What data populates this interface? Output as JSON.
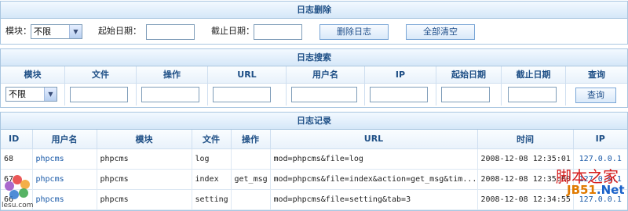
{
  "delete_panel": {
    "title": "日志删除",
    "module_label": "模块：",
    "module_value": "不限",
    "start_label": "起始日期：",
    "end_label": "截止日期：",
    "delete_button": "删除日志",
    "clear_all_button": "全部清空"
  },
  "search_panel": {
    "title": "日志搜索",
    "headers": [
      "模块",
      "文件",
      "操作",
      "URL",
      "用户名",
      "IP",
      "起始日期",
      "截止日期",
      "查询"
    ],
    "module_value": "不限",
    "search_button": "查询"
  },
  "log_panel": {
    "title": "日志记录",
    "headers": [
      "ID",
      "用户名",
      "模块",
      "文件",
      "操作",
      "URL",
      "时间",
      "IP"
    ],
    "rows": [
      {
        "id": "68",
        "user": "phpcms",
        "module": "phpcms",
        "file": "log",
        "action": "",
        "url": "mod=phpcms&file=log",
        "time": "2008-12-08 12:35:01",
        "ip": "127.0.0.1"
      },
      {
        "id": "67",
        "user": "phpcms",
        "module": "phpcms",
        "file": "index",
        "action": "get_msg",
        "url": "mod=phpcms&file=index&action=get_msg&tim...",
        "time": "2008-12-08 12:35:00",
        "ip": "127.0.0.1"
      },
      {
        "id": "66",
        "user": "phpcms",
        "module": "phpcms",
        "file": "setting",
        "action": "",
        "url": "mod=phpcms&file=setting&tab=3",
        "time": "2008-12-08 12:34:55",
        "ip": "127.0.0.1"
      }
    ]
  },
  "watermarks": {
    "left_site": "lesu.com",
    "right_line1": "脚本之家",
    "right_jb": "JB51",
    "right_net": ".Net"
  },
  "colors": {
    "title_text": "#1e4f86",
    "border": "#a9c6e0",
    "link": "#1a5aa8"
  }
}
